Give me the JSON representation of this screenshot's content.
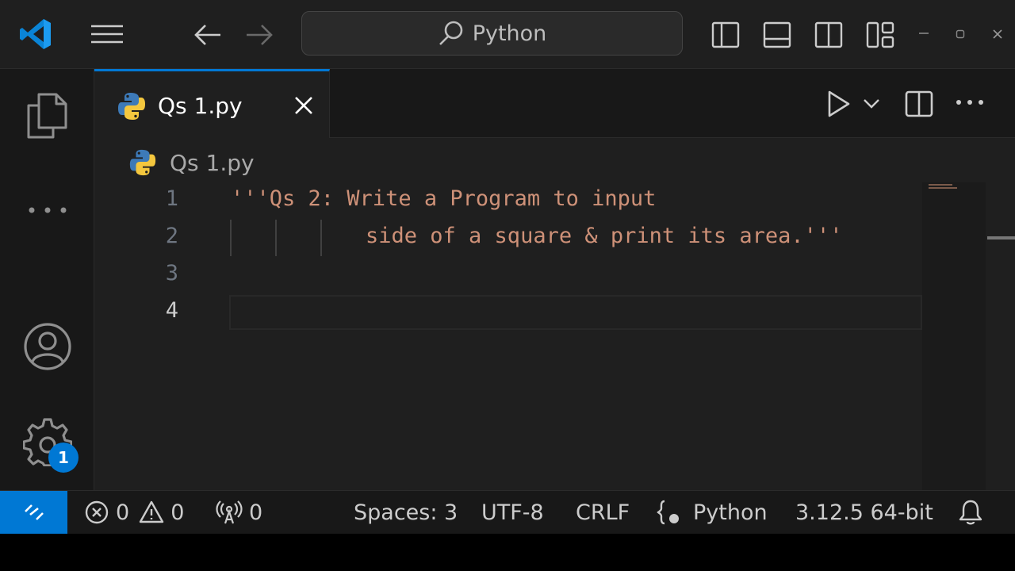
{
  "titlebar": {
    "search_text": "Python"
  },
  "activitybar": {
    "settings_badge": "1"
  },
  "tabs": [
    {
      "label": "Qs 1.py"
    }
  ],
  "breadcrumb": {
    "file": "Qs 1.py"
  },
  "editor": {
    "line_numbers": [
      "1",
      "2",
      "3",
      "4"
    ],
    "lines": [
      "'''Qs 2: Write a Program to input",
      "side of a square & print its area.'''",
      "",
      ""
    ]
  },
  "statusbar": {
    "errors": "0",
    "warnings": "0",
    "ports": "0",
    "spaces": "Spaces: 3",
    "encoding": "UTF-8",
    "eol": "CRLF",
    "language": "Python",
    "interpreter": "3.12.5 64-bit"
  },
  "colors": {
    "accent": "#0078d4",
    "string": "#ce9178",
    "editor_bg": "#1f1f1f"
  }
}
